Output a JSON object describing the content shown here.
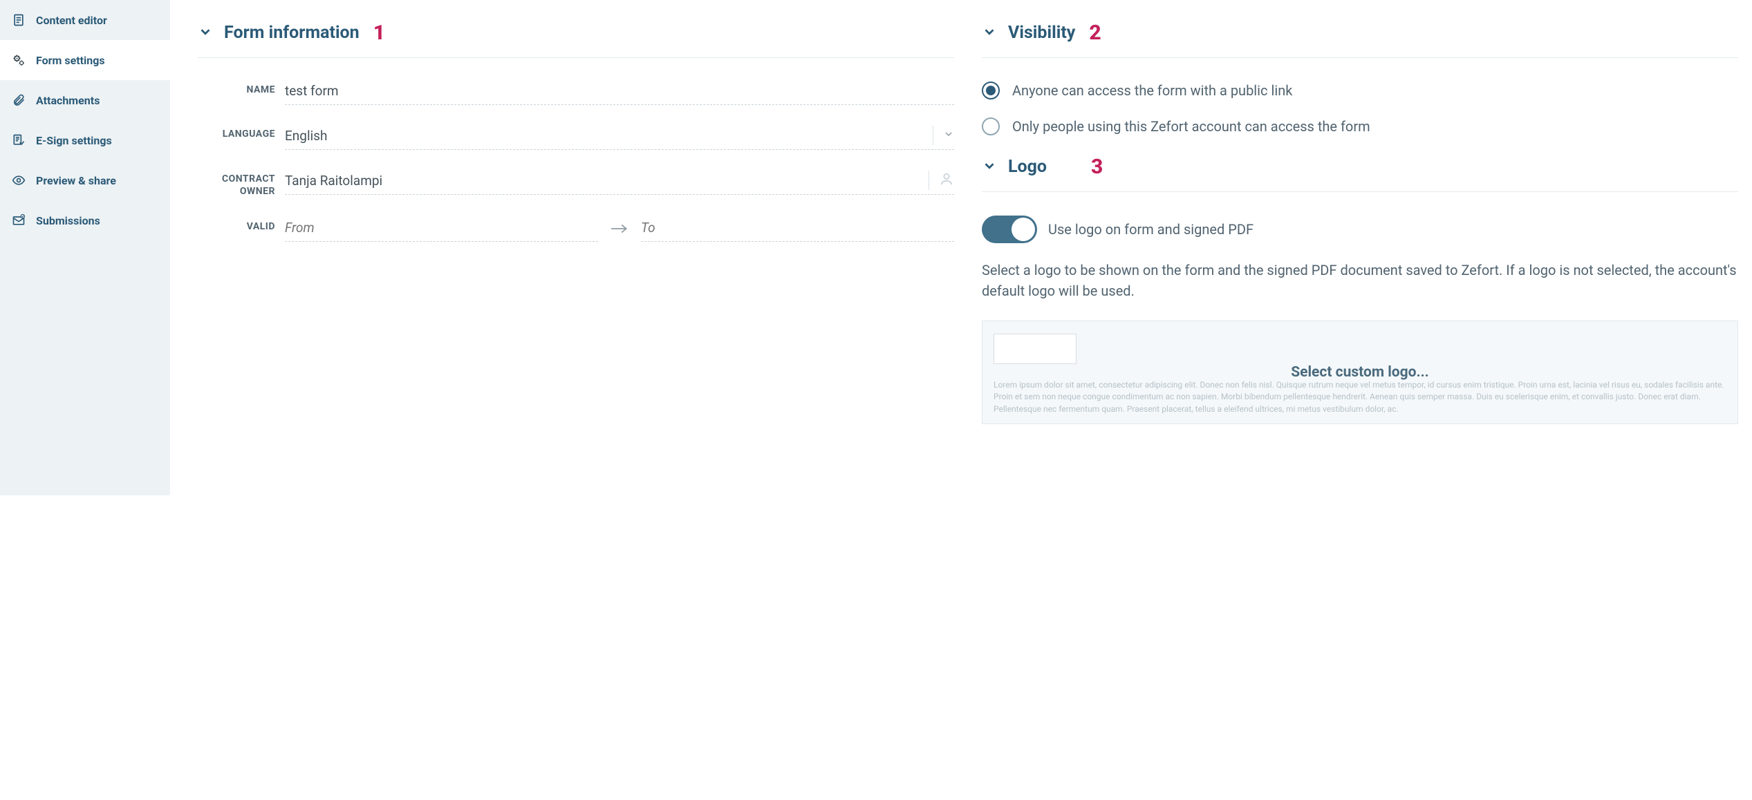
{
  "sidebar": {
    "items": [
      {
        "label": "Content editor"
      },
      {
        "label": "Form settings"
      },
      {
        "label": "Attachments"
      },
      {
        "label": "E-Sign settings"
      },
      {
        "label": "Preview & share"
      },
      {
        "label": "Submissions"
      }
    ],
    "active_index": 1
  },
  "sections": {
    "form_info": {
      "title": "Form information",
      "num": "1"
    },
    "visibility": {
      "title": "Visibility",
      "num": "2"
    },
    "logo": {
      "title": "Logo",
      "num": "3"
    }
  },
  "form": {
    "name_label": "NAME",
    "name_value": "test form",
    "language_label": "LANGUAGE",
    "language_value": "English",
    "owner_label": "CONTRACT OWNER",
    "owner_value": "Tanja Raitolampi",
    "valid_label": "VALID",
    "valid_from_placeholder": "From",
    "valid_to_placeholder": "To"
  },
  "visibility": {
    "options": [
      {
        "label": "Anyone can access the form with a public link",
        "selected": true
      },
      {
        "label": "Only people using this Zefort account can access the form",
        "selected": false
      }
    ]
  },
  "logo": {
    "toggle_label": "Use logo on form and signed PDF",
    "toggle_on": true,
    "description": "Select a logo to be shown on the form and the signed PDF document saved to Zefort. If a logo is not selected, the account's default logo will be used.",
    "select_label": "Select custom logo...",
    "lorem": "Lorem ipsum dolor sit amet, consectetur adipiscing elit. Donec non felis nisl. Quisque rutrum neque vel metus tempor, id cursus enim tristique. Proin urna est, lacinia vel risus eu, sodales facilisis ante. Proin et sem non neque congue condimentum ac non sapien. Morbi bibendum pellentesque hendrerit. Aenean quis semper massa. Duis eu scelerisque enim, et convallis justo. Donec erat diam. Pellentesque nec fermentum quam. Praesent placerat, tellus a eleifend ultrices, mi metus vestibulum dolor, ac."
  }
}
